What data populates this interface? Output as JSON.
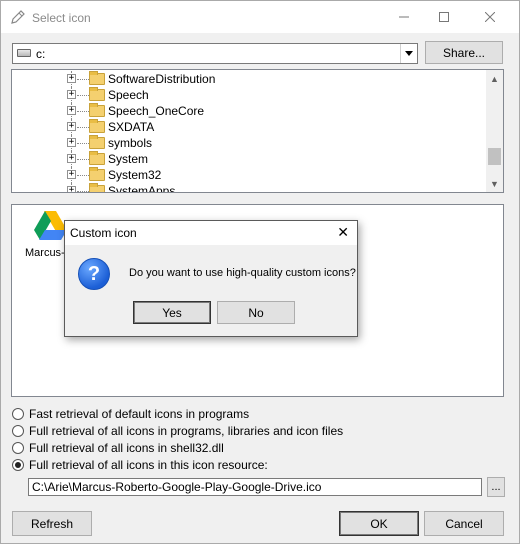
{
  "window": {
    "title": "Select icon",
    "icon": "edit-icon",
    "controls": [
      "minimize-icon",
      "maximize-icon",
      "close-icon"
    ]
  },
  "drive": {
    "value": "c:",
    "icon": "hard-drive-icon"
  },
  "buttons": {
    "share": "Share...",
    "refresh": "Refresh",
    "ok": "OK",
    "cancel": "Cancel",
    "browse": "..."
  },
  "tree": {
    "items": [
      "SoftwareDistribution",
      "Speech",
      "Speech_OneCore",
      "SXDATA",
      "symbols",
      "System",
      "System32",
      "SystemApps"
    ],
    "selected": "System32"
  },
  "icons_pane": {
    "items": [
      {
        "caption": "Marcus-..."
      }
    ]
  },
  "options": [
    {
      "label": "Fast retrieval of default icons in programs",
      "selected": false
    },
    {
      "label": "Full retrieval of all icons in programs, libraries and icon files",
      "selected": false
    },
    {
      "label": "Full retrieval of all icons in shell32.dll",
      "selected": false
    },
    {
      "label": "Full retrieval of all icons in this icon resource:",
      "selected": true
    }
  ],
  "path": "C:\\Arie\\Marcus-Roberto-Google-Play-Google-Drive.ico",
  "dialog": {
    "title": "Custom icon",
    "message": "Do you want to use high-quality custom icons?",
    "yes": "Yes",
    "no": "No",
    "icon": "question-icon"
  }
}
